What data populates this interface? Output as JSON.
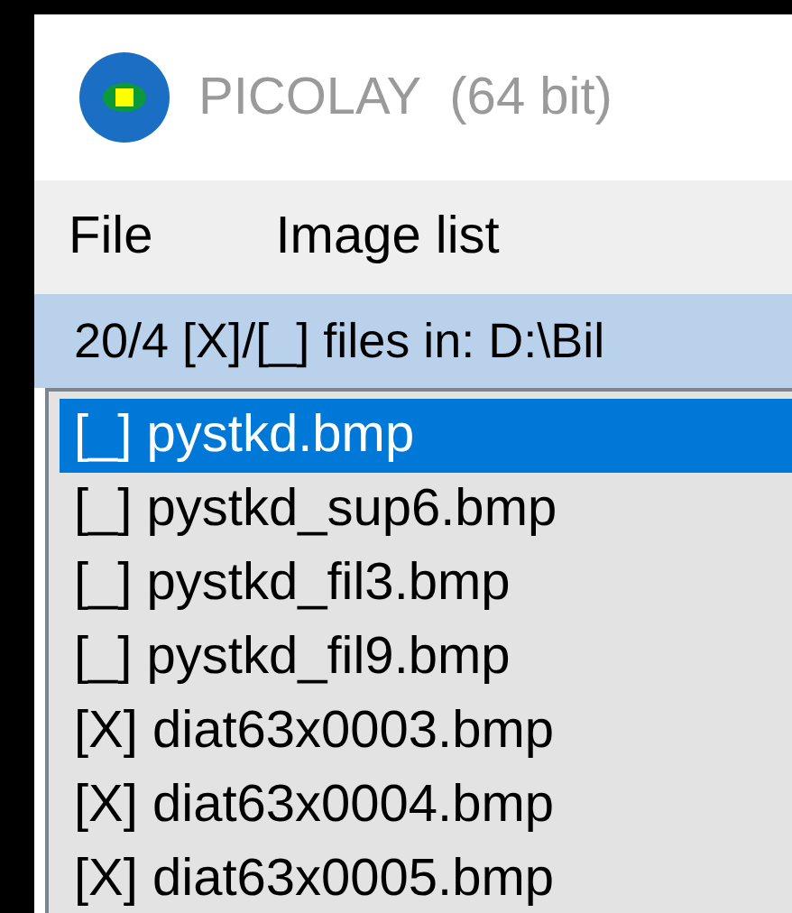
{
  "window": {
    "title": "PICOLAY  (64 bit)"
  },
  "menu": [
    "File",
    "Image list"
  ],
  "group": {
    "title": "20/4 [X]/[_] files in: D:\\Bil"
  },
  "files": [
    {
      "label": "[_] pystkd.bmp",
      "selected": true
    },
    {
      "label": "[_] pystkd_sup6.bmp",
      "selected": false
    },
    {
      "label": "[_] pystkd_fil3.bmp",
      "selected": false
    },
    {
      "label": "[_] pystkd_fil9.bmp",
      "selected": false
    },
    {
      "label": "[X] diat63x0003.bmp",
      "selected": false
    },
    {
      "label": "[X] diat63x0004.bmp",
      "selected": false
    },
    {
      "label": "[X] diat63x0005.bmp",
      "selected": false
    }
  ]
}
